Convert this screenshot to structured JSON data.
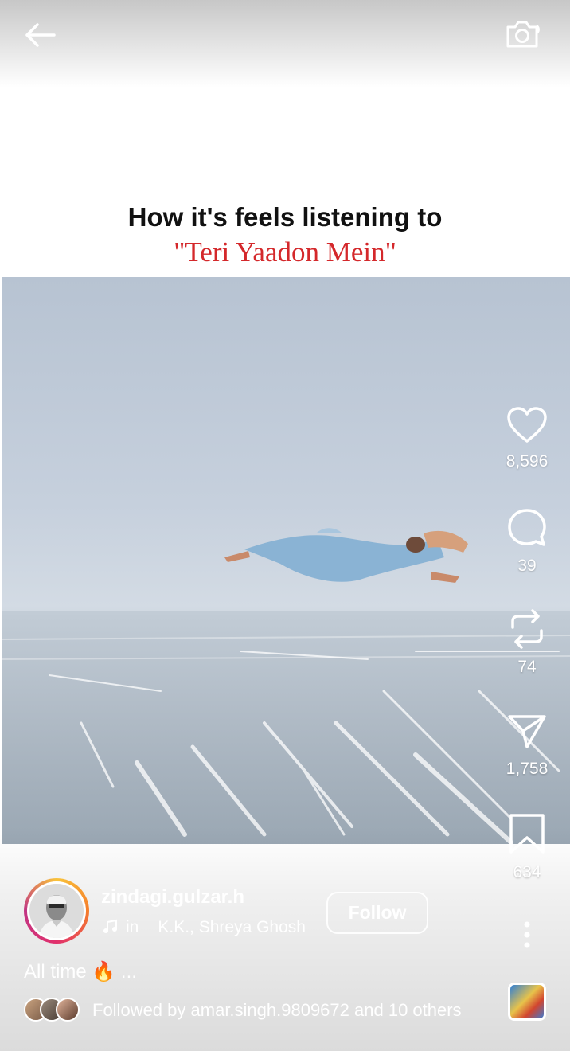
{
  "caption": {
    "line1": "How it's feels listening to",
    "line2": "\"Teri Yaadon Mein\""
  },
  "actions": {
    "likes": "8,596",
    "comments": "39",
    "reposts": "74",
    "shares": "1,758",
    "saves": "634"
  },
  "author": {
    "username": "zindagi.gulzar.h",
    "music_prefix": "in",
    "music_artists": "K.K., Shreya Ghosh",
    "follow_label": "Follow"
  },
  "description": "All time 🔥 ...",
  "followed_by": {
    "prefix": "Followed by",
    "user": "amar.singh.9809672",
    "suffix": "and 10 others"
  },
  "icons": {
    "back": "arrow-left-icon",
    "camera": "camera-icon",
    "like": "heart-icon",
    "comment": "comment-bubble-icon",
    "repost": "repost-icon",
    "share": "send-icon",
    "save": "bookmark-icon",
    "more": "more-vertical-icon",
    "music": "music-note-icon"
  },
  "colors": {
    "caption_accent": "#d4282b",
    "story_ring": [
      "#f9c33a",
      "#e1306c",
      "#c13584"
    ]
  }
}
